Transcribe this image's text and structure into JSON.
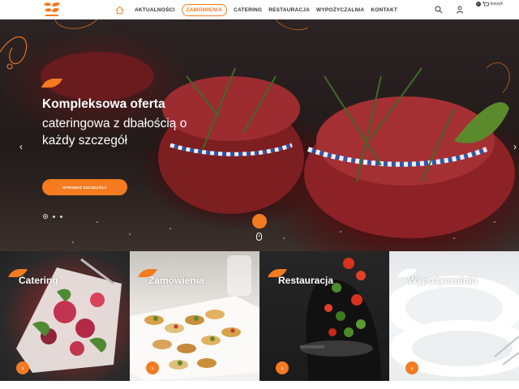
{
  "brand": {
    "accent": "#f47b20",
    "logo_name": "catering-logo"
  },
  "nav": {
    "home_icon": "home-icon",
    "items": [
      {
        "label": "AKTUALNOŚCI",
        "active": false
      },
      {
        "label": "ZAMÓWIENIA",
        "active": true
      },
      {
        "label": "CATERING",
        "active": false
      },
      {
        "label": "RESTAURACJA",
        "active": false
      },
      {
        "label": "WYPOŻYCZALNIA",
        "active": false
      },
      {
        "label": "KONTAKT",
        "active": false
      }
    ]
  },
  "header_icons": {
    "search": "search-icon",
    "user": "user-icon",
    "cart": "cart-icon",
    "cart_count": "0",
    "cart_label": "koszyk"
  },
  "hero": {
    "title": "Kompleksowa oferta",
    "subtitle": "cateringowa z dbałością o każdy szczegół",
    "button": "SPRAWDŹ SZCZEGÓŁY",
    "prev": "‹",
    "next": "›",
    "slides": 3,
    "active_slide": 1
  },
  "tiles": [
    {
      "label": "Catering",
      "go": "›"
    },
    {
      "label": "Zamówienia",
      "go": "›"
    },
    {
      "label": "Restauracja",
      "go": "›"
    },
    {
      "label": "Wypożyczalnia",
      "go": "›"
    }
  ]
}
